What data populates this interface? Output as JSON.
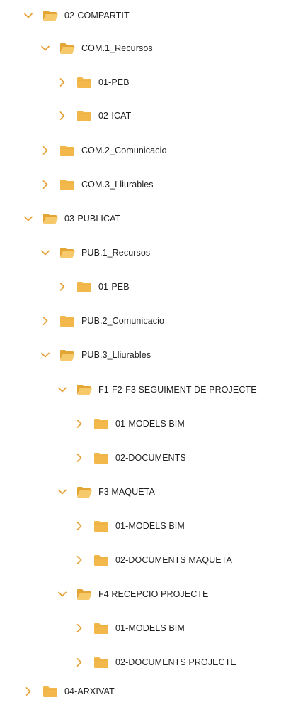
{
  "tree": {
    "items": [
      {
        "label": "02-COMPARTIT",
        "expanded": true
      },
      {
        "label": "COM.1_Recursos",
        "expanded": true
      },
      {
        "label": "01-PEB",
        "expanded": false
      },
      {
        "label": "02-ICAT",
        "expanded": false
      },
      {
        "label": "COM.2_Comunicacio",
        "expanded": false
      },
      {
        "label": "COM.3_Lliurables",
        "expanded": false
      },
      {
        "label": "03-PUBLICAT",
        "expanded": true
      },
      {
        "label": "PUB.1_Recursos",
        "expanded": true
      },
      {
        "label": "01-PEB",
        "expanded": false
      },
      {
        "label": "PUB.2_Comunicacio",
        "expanded": false
      },
      {
        "label": "PUB.3_Lliurables",
        "expanded": true
      },
      {
        "label": "F1-F2-F3 SEGUIMENT DE PROJECTE",
        "expanded": true
      },
      {
        "label": "01-MODELS BIM",
        "expanded": false
      },
      {
        "label": "02-DOCUMENTS",
        "expanded": false
      },
      {
        "label": "F3 MAQUETA",
        "expanded": true
      },
      {
        "label": "01-MODELS BIM",
        "expanded": false
      },
      {
        "label": "02-DOCUMENTS MAQUETA",
        "expanded": false
      },
      {
        "label": "F4 RECEPCIO PROJECTE",
        "expanded": true
      },
      {
        "label": "01-MODELS BIM",
        "expanded": false
      },
      {
        "label": "02-DOCUMENTS PROJECTE",
        "expanded": false
      },
      {
        "label": "04-ARXIVAT",
        "expanded": false
      }
    ]
  },
  "colors": {
    "chevron": "#e8a33a",
    "folder_body": "#f2b84b",
    "folder_back": "#e3a534",
    "folder_open_front": "#f6c96a",
    "text": "#1f1f1f"
  },
  "icons": {
    "expanded": "chevron-down-icon",
    "collapsed": "chevron-right-icon",
    "folder_open": "folder-open-icon",
    "folder_closed": "folder-icon"
  }
}
